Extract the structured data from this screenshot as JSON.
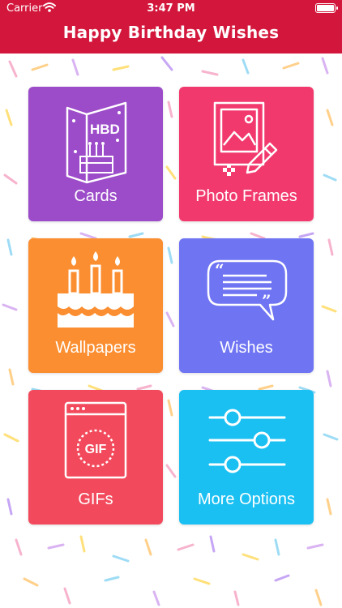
{
  "status_bar": {
    "carrier": "Carrier",
    "time": "3:47 PM"
  },
  "header": {
    "title": "Happy Birthday Wishes",
    "color": "#d3173c"
  },
  "menu": {
    "cards": {
      "label": "Cards",
      "color": "#9c4bc9",
      "icon": "birthday-card-icon"
    },
    "photo_frames": {
      "label": "Photo Frames",
      "color": "#f2396d",
      "icon": "photo-frame-icon"
    },
    "wallpapers": {
      "label": "Wallpapers",
      "color": "#fb8e30",
      "icon": "cake-icon"
    },
    "wishes": {
      "label": "Wishes",
      "color": "#6f74f3",
      "icon": "speech-bubble-icon"
    },
    "gifs": {
      "label": "GIFs",
      "color": "#f24a5c",
      "icon": "gif-icon"
    },
    "more_options": {
      "label": "More Options",
      "color": "#1ac0f2",
      "icon": "sliders-icon"
    }
  },
  "hbd_text": "HBD",
  "gif_text": "GIF"
}
